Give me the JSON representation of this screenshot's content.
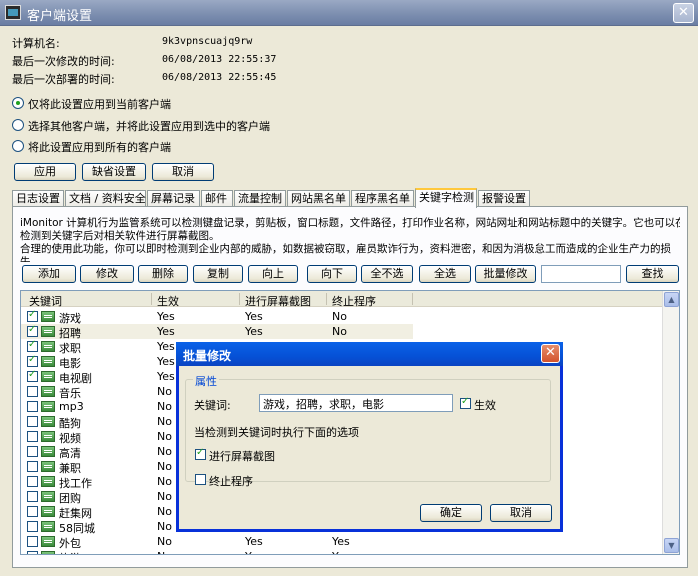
{
  "window": {
    "title": "客户端设置",
    "close_glyph": "✕"
  },
  "info": {
    "computer_label": "计算机名:",
    "computer_value": "9k3vpnscuajq9rw",
    "modified_label": "最后一次修改的时间:",
    "modified_value": "06/08/2013 22:55:37",
    "deployed_label": "最后一次部署的时间:",
    "deployed_value": "06/08/2013 22:55:45"
  },
  "scope": [
    {
      "label": "仅将此设置应用到当前客户端",
      "selected": true
    },
    {
      "label": "选择其他客户端，并将此设置应用到选中的客户端",
      "selected": false
    },
    {
      "label": "将此设置应用到所有的客户端",
      "selected": false
    }
  ],
  "actions": {
    "apply": "应用",
    "default": "缺省设置",
    "cancel": "取消"
  },
  "tabs": [
    "日志设置",
    "文档 / 资料安全",
    "屏幕记录",
    "邮件",
    "流量控制",
    "网站黑名单",
    "程序黑名单",
    "关键字检测",
    "报警设置"
  ],
  "active_tab": "关键字检测",
  "description": [
    "iMonitor 计算机行为监管系统可以检测键盘记录，剪贴板，窗口标题，文件路径，打印作业名称，网站网址和网站标题中的关键字。它也可以在",
    "检测到关键字后对相关软件进行屏幕截图。",
    "合理的使用此功能，你可以即时检测到企业内部的威胁，如数据被窃取，雇员欺诈行为，资料泄密，和因为消极怠工而造成的企业生产力的损",
    "失。"
  ],
  "toolbar": {
    "add": "添加",
    "edit": "修改",
    "delete": "删除",
    "copy": "复制",
    "up": "向上",
    "down": "向下",
    "select_none": "全不选",
    "select_all": "全选",
    "batch_edit": "批量修改",
    "search": "查找",
    "search_value": ""
  },
  "columns": [
    "关键词",
    "生效",
    "进行屏幕截图",
    "终止程序"
  ],
  "rows": [
    {
      "checked": true,
      "keyword": "游戏",
      "active": "Yes",
      "screenshot": "Yes",
      "terminate": "No"
    },
    {
      "checked": true,
      "keyword": "招聘",
      "active": "Yes",
      "screenshot": "Yes",
      "terminate": "No"
    },
    {
      "checked": true,
      "keyword": "求职",
      "active": "Yes",
      "screenshot": "",
      "terminate": ""
    },
    {
      "checked": true,
      "keyword": "电影",
      "active": "Yes",
      "screenshot": "",
      "terminate": ""
    },
    {
      "checked": true,
      "keyword": "电视剧",
      "active": "Yes",
      "screenshot": "",
      "terminate": ""
    },
    {
      "checked": false,
      "keyword": "音乐",
      "active": "No",
      "screenshot": "",
      "terminate": ""
    },
    {
      "checked": false,
      "keyword": "mp3",
      "active": "No",
      "screenshot": "",
      "terminate": ""
    },
    {
      "checked": false,
      "keyword": "酷狗",
      "active": "No",
      "screenshot": "",
      "terminate": ""
    },
    {
      "checked": false,
      "keyword": "视频",
      "active": "No",
      "screenshot": "",
      "terminate": ""
    },
    {
      "checked": false,
      "keyword": "高清",
      "active": "No",
      "screenshot": "",
      "terminate": ""
    },
    {
      "checked": false,
      "keyword": "兼职",
      "active": "No",
      "screenshot": "",
      "terminate": ""
    },
    {
      "checked": false,
      "keyword": "找工作",
      "active": "No",
      "screenshot": "",
      "terminate": ""
    },
    {
      "checked": false,
      "keyword": "团购",
      "active": "No",
      "screenshot": "",
      "terminate": ""
    },
    {
      "checked": false,
      "keyword": "赶集网",
      "active": "No",
      "screenshot": "",
      "terminate": ""
    },
    {
      "checked": false,
      "keyword": "58同城",
      "active": "No",
      "screenshot": "",
      "terminate": ""
    },
    {
      "checked": false,
      "keyword": "外包",
      "active": "No",
      "screenshot": "Yes",
      "terminate": "Yes"
    },
    {
      "checked": false,
      "keyword": "旅游",
      "active": "No",
      "screenshot": "Yes",
      "terminate": "Yes"
    }
  ],
  "dialog": {
    "title": "批量修改",
    "close_glyph": "✕",
    "group_label": "属性",
    "keyword_label": "关键词:",
    "keyword_value": "游戏，招聘，求职，电影",
    "active_label": "生效",
    "active_checked": true,
    "when_label": "当检测到关键词时执行下面的选项",
    "screenshot_label": "进行屏幕截图",
    "screenshot_checked": true,
    "terminate_label": "终止程序",
    "terminate_checked": false,
    "ok": "确定",
    "cancel": "取消"
  },
  "scroll": {
    "up_glyph": "▲",
    "down_glyph": "▼"
  }
}
